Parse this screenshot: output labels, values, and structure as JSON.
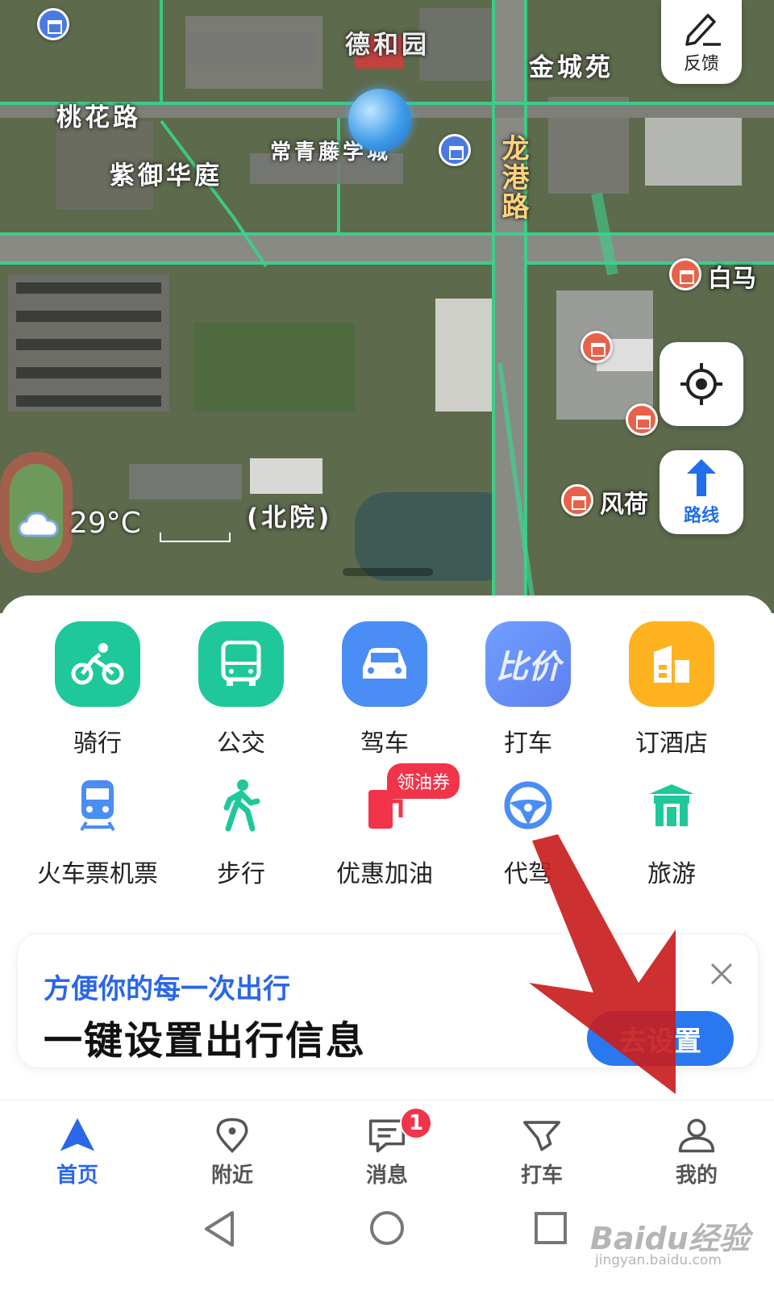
{
  "map": {
    "labels": {
      "road_taohua": "桃花路",
      "road_longgang": "龙港路",
      "place_dehe": "德和园",
      "place_zijin": "紫御华庭",
      "place_changqing": "常青藤学城",
      "place_jincheng": "金城苑",
      "place_north": "(北院)",
      "poi_baima": "白马",
      "poi_fenghe": "风荷"
    },
    "weather": {
      "icon": "cloud-icon",
      "temperature": "29°C"
    }
  },
  "map_controls": {
    "feedback_label": "反馈",
    "route_label": "路线"
  },
  "services_row1": [
    {
      "label": "骑行",
      "color": "#1fc89a",
      "icon": "bike-icon"
    },
    {
      "label": "公交",
      "color": "#1fc89a",
      "icon": "bus-icon"
    },
    {
      "label": "驾车",
      "color": "#4a8df5",
      "icon": "car-icon"
    },
    {
      "label": "打车",
      "color": "#6f8ff5",
      "icon": "taxi-icon",
      "tile_text": "比价"
    },
    {
      "label": "订酒店",
      "color": "#ffb21f",
      "icon": "hotel-icon"
    }
  ],
  "services_row2": [
    {
      "label": "火车票机票",
      "icon": "train-icon"
    },
    {
      "label": "步行",
      "icon": "walk-icon"
    },
    {
      "label": "优惠加油",
      "icon": "fuel-icon",
      "badge": "领油券"
    },
    {
      "label": "代驾",
      "icon": "steering-wheel-icon"
    },
    {
      "label": "旅游",
      "icon": "gate-icon"
    }
  ],
  "promo": {
    "subtitle": "方便你的每一次出行",
    "title": "一键设置出行信息",
    "button_label": "去设置"
  },
  "tabbar": [
    {
      "label": "首页",
      "icon": "navigation-arrow-icon",
      "active": true
    },
    {
      "label": "附近",
      "icon": "location-pin-icon"
    },
    {
      "label": "消息",
      "icon": "message-icon",
      "badge": "1"
    },
    {
      "label": "打车",
      "icon": "taxi-flag-icon"
    },
    {
      "label": "我的",
      "icon": "user-icon"
    }
  ],
  "watermark": {
    "text": "Baidu经验",
    "sub": "jingyan.baidu.com"
  },
  "colors": {
    "accent": "#2a67e8",
    "badge_red": "#f2344a",
    "arrow_red": "#c81e1e"
  }
}
